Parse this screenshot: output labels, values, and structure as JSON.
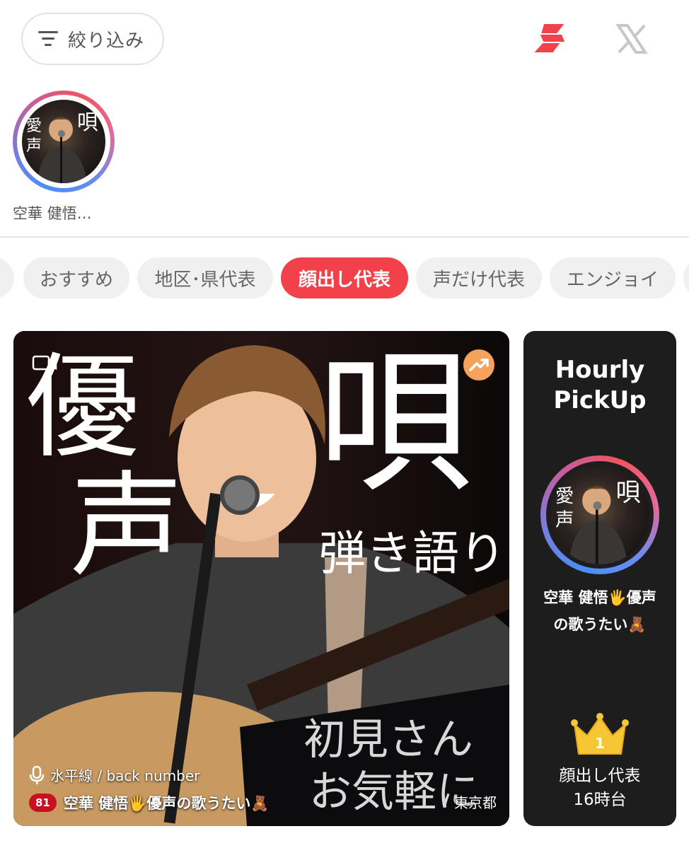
{
  "header": {
    "filter_label": "絞り込み",
    "filter_icon": "filter-lines-icon",
    "app_icon": "s-logo-icon",
    "x_icon": "x-logo-icon",
    "accent": "#f2414a"
  },
  "stories": [
    {
      "name": "空華 健悟…"
    }
  ],
  "tabs": [
    {
      "label": "おすすめ",
      "active": false
    },
    {
      "label": "地区･県代表",
      "active": false
    },
    {
      "label": "顔出し代表",
      "active": true
    },
    {
      "label": "声だけ代表",
      "active": false
    },
    {
      "label": "エンジョイ",
      "active": false
    }
  ],
  "main_card": {
    "thumb_text": {
      "big_left_1": "優",
      "big_left_2": "声",
      "big_right": "唄",
      "sub_right": "弾き語り",
      "bottom_1": "初見さん",
      "bottom_2": "お気軽に"
    },
    "song": "水平線 / back number",
    "count": "81",
    "title": "空華 健悟🖐️優声の歌うたい🧸",
    "location": "東京都",
    "trend_color": "#f5a35c"
  },
  "side_card": {
    "title_line1": "Hourly",
    "title_line2": "PickUp",
    "name_line1": "空華 健悟🖐️優声",
    "name_line2": "の歌うたい🧸",
    "rank_number": "1",
    "rank_category": "顔出し代表",
    "rank_time": "16時台",
    "crown_color": "#f7c634"
  }
}
